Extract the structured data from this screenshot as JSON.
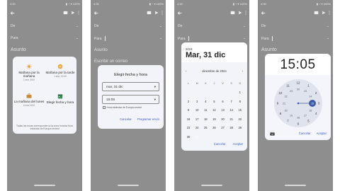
{
  "status": {
    "time": "4:30",
    "icons": "▮ ◔ ▾ 100%"
  },
  "compose": {
    "de_label": "De",
    "para_label": "Para",
    "asunto_label": "Asunto",
    "body_placeholder": "Escribir un correo"
  },
  "colors": {
    "overlay": "#8e8e8e",
    "dialog": "#f3f4f9",
    "accent": "#3d5aa8",
    "action": "#3a5cc5"
  },
  "panel1": {
    "options": [
      {
        "label": "Mañana por la mañana",
        "sub": "1 ene, 8:00",
        "icon": "sun-icon"
      },
      {
        "label": "Mañana por la tarde",
        "sub": "1 ene, 13:00",
        "icon": "sun-icon"
      },
      {
        "label": "La mañana del lunes",
        "sub": "6 ene, 8:00",
        "icon": "briefcase-icon"
      },
      {
        "label": "Elegir fecha y hora",
        "sub": "",
        "icon": "calendar-icon"
      }
    ],
    "note": "Todas las horas corresponden a la zona horaria Hora estándar de Europa central"
  },
  "panel2": {
    "title": "Elegir fecha y hora",
    "date_value": "mar, 31 dic",
    "time_value": "15:05",
    "tz_label": "Hora estándar de Europa central",
    "cancel": "Cancelar",
    "confirm": "Programar envío"
  },
  "panel3": {
    "year": "2024",
    "header_date": "Mar, 31 dic",
    "month": "diciembre de 2024",
    "weekdays": [
      "L",
      "M",
      "X",
      "J",
      "V",
      "S",
      "D"
    ],
    "weeks": [
      [
        "",
        "",
        "",
        "",
        "",
        "",
        "1"
      ],
      [
        "2",
        "3",
        "4",
        "5",
        "6",
        "7",
        "8"
      ],
      [
        "9",
        "10",
        "11",
        "12",
        "13",
        "14",
        "15"
      ],
      [
        "16",
        "17",
        "18",
        "19",
        "20",
        "21",
        "22"
      ],
      [
        "23",
        "24",
        "25",
        "26",
        "27",
        "28",
        "29"
      ],
      [
        "30",
        "31",
        "",
        "",
        "",
        "",
        ""
      ]
    ],
    "selected_day": "31",
    "cancel": "Cancelar",
    "accept": "Aceptar"
  },
  "panel4": {
    "time": "15:05",
    "hours_outer": [
      "12",
      "1",
      "2",
      "3",
      "4",
      "5",
      "6",
      "7",
      "8",
      "9",
      "10",
      "11"
    ],
    "hours_inner": [
      "00",
      "13",
      "14",
      "15",
      "16",
      "17",
      "18",
      "19",
      "20",
      "21",
      "22",
      "23"
    ],
    "selected_hour": "15",
    "cancel": "Cancelar",
    "accept": "Aceptar"
  }
}
